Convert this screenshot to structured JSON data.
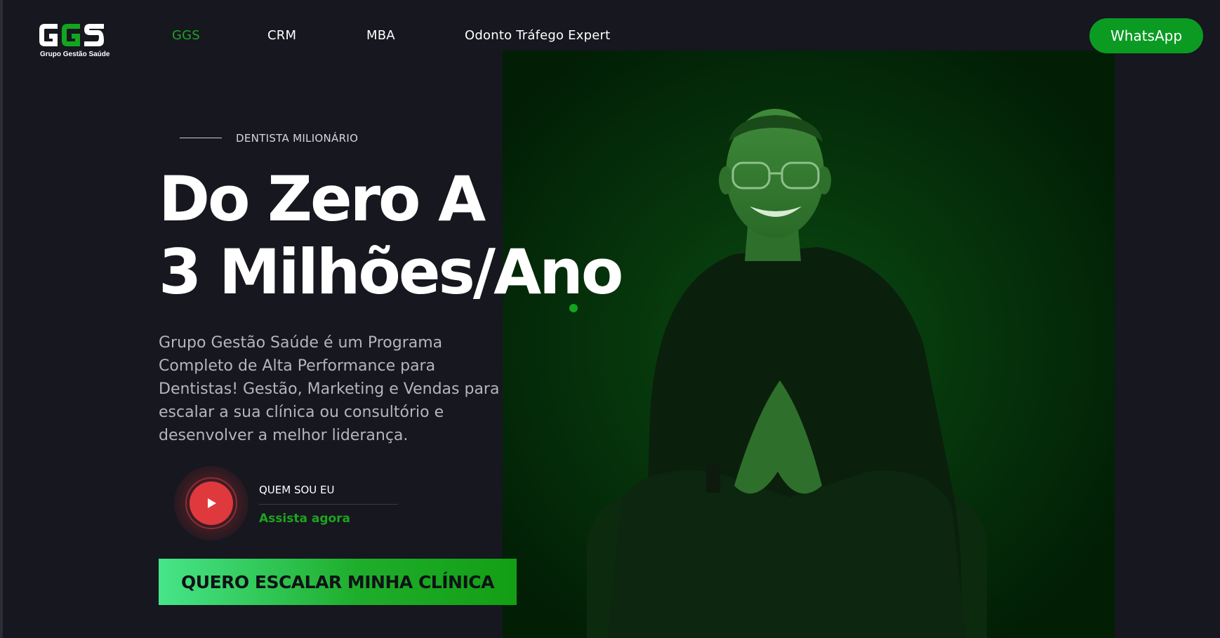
{
  "brand": {
    "logo_text": "GGS",
    "logo_caption": "Grupo Gestão Saúde",
    "accent_color": "#12a51f",
    "background_color": "#16171f"
  },
  "nav": {
    "items": [
      {
        "label": "GGS",
        "active": true
      },
      {
        "label": "CRM",
        "active": false
      },
      {
        "label": "MBA",
        "active": false
      },
      {
        "label": "Odonto Tráfego Expert",
        "active": false
      }
    ],
    "whatsapp_label": "WhatsApp"
  },
  "hero": {
    "eyebrow": "DENTISTA MILIONÁRIO",
    "headline_line1": "Do Zero A",
    "headline_line2": "3 Milhões/Ano",
    "description": "Grupo Gestão Saúde é um Programa Completo de Alta Performance para Dentistas! Gestão, Marketing e Vendas para escalar a sua clínica ou consultório e desenvolver a melhor liderança.",
    "video": {
      "title": "QUEM SOU EU",
      "subtitle": "Assista agora",
      "icon": "play-icon"
    },
    "cta_label": "QUERO ESCALAR MINHA CLÍNICA"
  }
}
